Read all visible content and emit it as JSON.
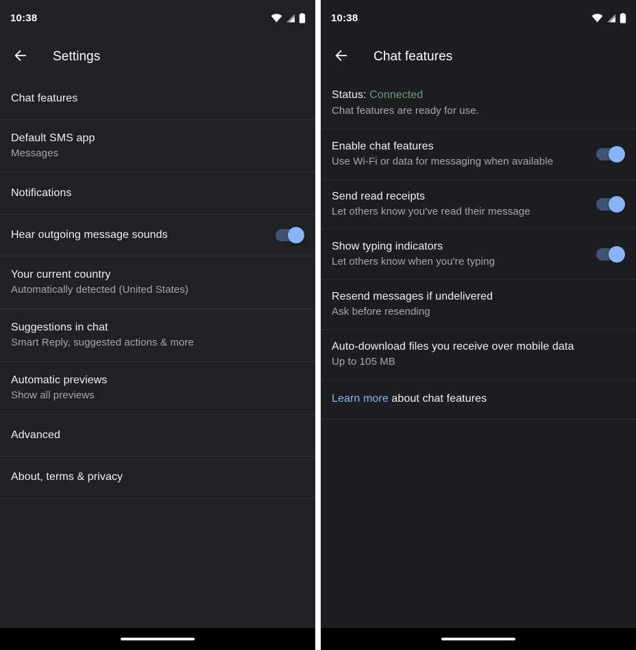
{
  "statusbar": {
    "time": "10:38",
    "icons": [
      "wifi-icon",
      "cell-signal-icon",
      "battery-icon"
    ]
  },
  "colors": {
    "background_left": "#1f2124",
    "background_right": "#1c1e21",
    "divider": "#2e3033",
    "title_text": "#f1f1f1",
    "subtitle_text": "#a6a8ab",
    "toggle_thumb": "#8ab4f8",
    "toggle_track": "#3f5372",
    "link": "#8ab4f8",
    "status_connected": "#6f9b77",
    "navbar": "#000000"
  },
  "left_screen": {
    "toolbar": {
      "back_icon": "arrow-back-icon",
      "title": "Settings"
    },
    "rows": [
      {
        "title": "Chat features",
        "subtitle": "",
        "toggle": null
      },
      {
        "title": "Default SMS app",
        "subtitle": "Messages",
        "toggle": null
      },
      {
        "title": "Notifications",
        "subtitle": "",
        "toggle": null
      },
      {
        "title": "Hear outgoing message sounds",
        "subtitle": "",
        "toggle": "on"
      },
      {
        "title": "Your current country",
        "subtitle": "Automatically detected (United States)",
        "toggle": null
      },
      {
        "title": "Suggestions in chat",
        "subtitle": "Smart Reply, suggested actions & more",
        "toggle": null
      },
      {
        "title": "Automatic previews",
        "subtitle": "Show all previews",
        "toggle": null
      },
      {
        "title": "Advanced",
        "subtitle": "",
        "toggle": null
      },
      {
        "title": "About, terms & privacy",
        "subtitle": "",
        "toggle": null
      }
    ]
  },
  "right_screen": {
    "toolbar": {
      "back_icon": "arrow-back-icon",
      "title": "Chat features"
    },
    "status": {
      "label": "Status: ",
      "value": "Connected",
      "description": "Chat features are ready for use."
    },
    "rows": [
      {
        "title": "Enable chat features",
        "subtitle": "Use Wi-Fi or data for messaging when available",
        "toggle": "on"
      },
      {
        "title": "Send read receipts",
        "subtitle": "Let others know you've read their message",
        "toggle": "on"
      },
      {
        "title": "Show typing indicators",
        "subtitle": "Let others know when you're typing",
        "toggle": "on"
      },
      {
        "title": "Resend messages if undelivered",
        "subtitle": "Ask before resending",
        "toggle": null
      },
      {
        "title": "Auto-download files you receive over mobile data",
        "subtitle": "Up to 105 MB",
        "toggle": null
      }
    ],
    "learn_more": {
      "link_text": "Learn more",
      "rest_text": " about chat features"
    }
  }
}
